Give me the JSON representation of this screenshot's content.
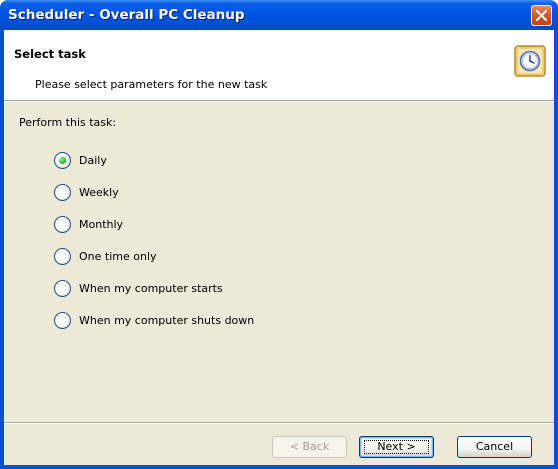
{
  "window": {
    "title": "Scheduler - Overall PC Cleanup",
    "close_icon": "close-icon"
  },
  "header": {
    "title": "Select task",
    "subtitle": "Please select parameters for the new task",
    "icon": "clock-icon"
  },
  "task": {
    "group_label": "Perform this task:",
    "options": [
      {
        "label": "Daily",
        "checked": true
      },
      {
        "label": "Weekly",
        "checked": false
      },
      {
        "label": "Monthly",
        "checked": false
      },
      {
        "label": "One time only",
        "checked": false
      },
      {
        "label": "When my computer starts",
        "checked": false
      },
      {
        "label": "When my computer shuts down",
        "checked": false
      }
    ]
  },
  "buttons": {
    "back": "< Back",
    "next": "Next >",
    "cancel": "Cancel"
  },
  "colors": {
    "titlebar": "#0054e3",
    "dialog_bg": "#ece9d8",
    "radio_checked": "#2ebd2e"
  }
}
